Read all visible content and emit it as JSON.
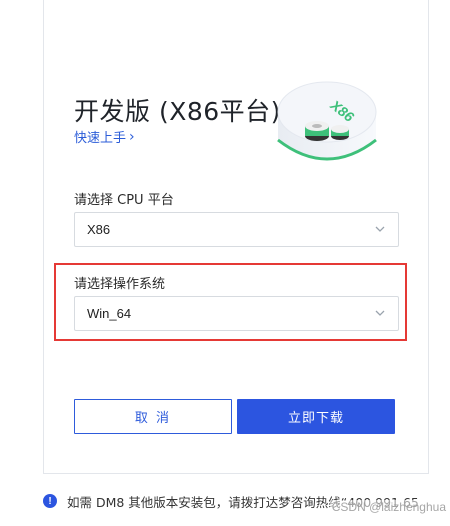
{
  "dialog": {
    "title": "开发版 (X86平台)",
    "quick_start": "快速上手",
    "illustration_text": "X86"
  },
  "cpu": {
    "label": "请选择 CPU 平台",
    "selected": "X86"
  },
  "os": {
    "label": "请选择操作系统",
    "selected": "Win_64"
  },
  "buttons": {
    "cancel": "取 消",
    "download": "立即下载"
  },
  "footer": {
    "info_icon": "!",
    "text": "如需 DM8 其他版本安装包，请拨打达梦咨询热线“400 991 65"
  },
  "watermark": "CSDN @laizhenghua",
  "colors": {
    "primary": "#2c55e0",
    "highlight": "#e53935",
    "green_accent": "#3ec07a"
  }
}
